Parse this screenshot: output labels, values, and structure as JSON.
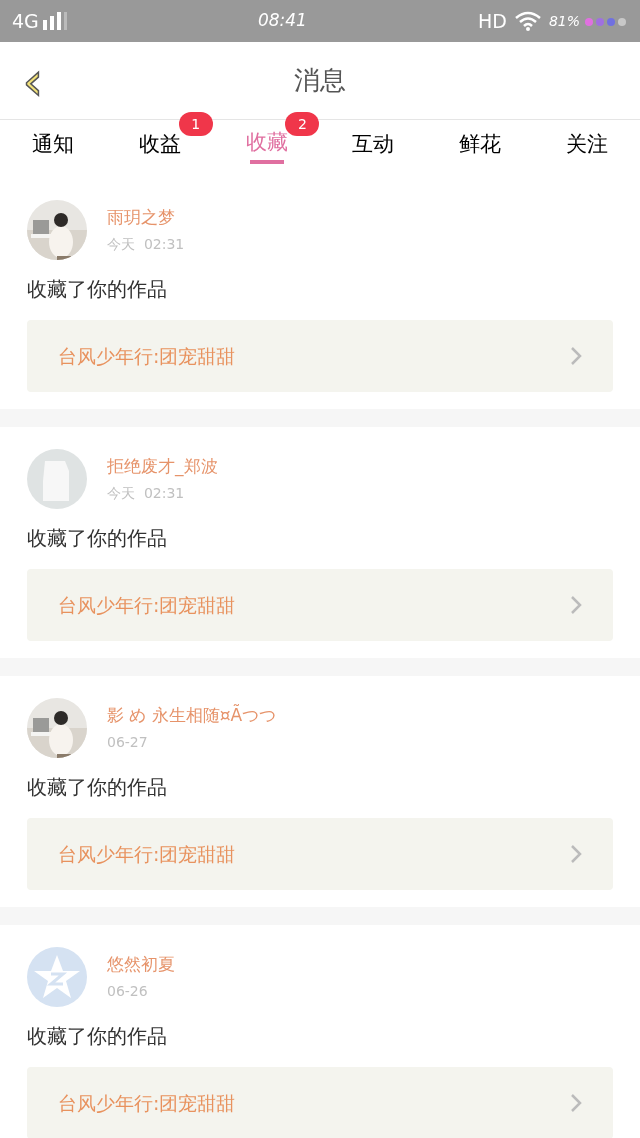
{
  "status_bar": {
    "network": "4G",
    "time": "08:41",
    "hd": "HD",
    "battery": "81%"
  },
  "header": {
    "back": "‹",
    "title": "消息"
  },
  "tabs": [
    {
      "label": "通知",
      "selected": false
    },
    {
      "label": "收益",
      "selected": false,
      "badge": "1"
    },
    {
      "label": "收藏",
      "selected": true,
      "badge": "2"
    },
    {
      "label": "互动",
      "selected": false
    },
    {
      "label": "鲜花",
      "selected": false
    },
    {
      "label": "关注",
      "selected": false
    }
  ],
  "messages": [
    {
      "kind": "picture",
      "name": "雨玥之梦",
      "time": "今天  02:31",
      "text": "收藏了你的作品",
      "work": "台风少年行:团宠甜甜"
    },
    {
      "kind": "default",
      "name": "拒绝废才_郑波",
      "time": "今天  02:31",
      "text": "收藏了你的作品",
      "work": "台风少年行:团宠甜甜"
    },
    {
      "kind": "picture",
      "name": "影 め 永生相随¤Ãつつ",
      "time": "06-27",
      "text": "收藏了你的作品",
      "work": "台风少年行:团宠甜甜"
    },
    {
      "kind": "star",
      "name": "悠然初夏",
      "time": "06-26",
      "text": "收藏了你的作品",
      "work": "台风少年行:团宠甜甜"
    }
  ]
}
